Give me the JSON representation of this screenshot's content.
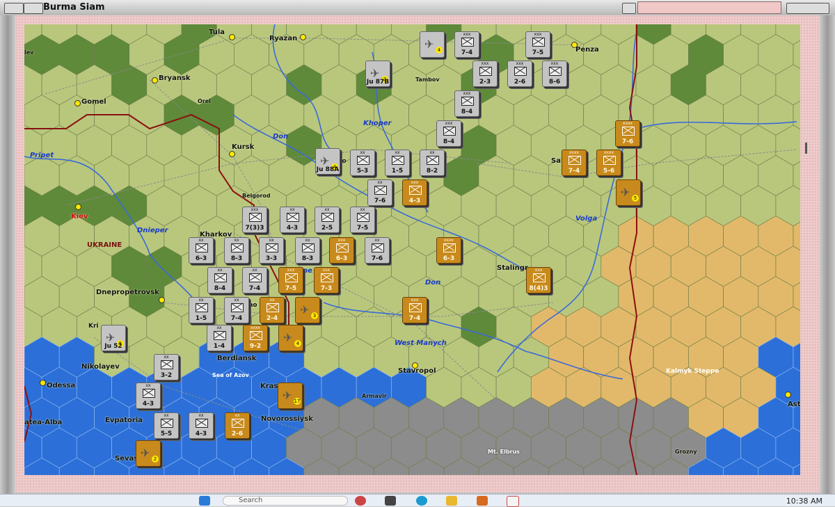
{
  "window": {
    "title": "Burma Siam"
  },
  "map": {
    "cities": [
      {
        "name": "Tula"
      },
      {
        "name": "Ryazan"
      },
      {
        "name": "Penza"
      },
      {
        "name": "Bryansk"
      },
      {
        "name": "Tambov"
      },
      {
        "name": "Orel"
      },
      {
        "name": "Gomel"
      },
      {
        "name": "Kursk"
      },
      {
        "name": "Saratov"
      },
      {
        "name": "Belgorod"
      },
      {
        "name": "Kiev"
      },
      {
        "name": "Kharkov"
      },
      {
        "name": "Stalingrad"
      },
      {
        "name": "Dnepropetrovsk"
      },
      {
        "name": "Nikolayev"
      },
      {
        "name": "Odessa"
      },
      {
        "name": "Berdiansk"
      },
      {
        "name": "Stavropol"
      },
      {
        "name": "Armavir"
      },
      {
        "name": "Krasnodar"
      },
      {
        "name": "Evpatoria"
      },
      {
        "name": "Novorossiysk"
      },
      {
        "name": "Sevastopol"
      },
      {
        "name": "Grozny"
      },
      {
        "name": "Astrakhan"
      },
      {
        "name": "Krivoi Rog"
      },
      {
        "name": "Feodosia-Alba"
      },
      {
        "name": "Rostov"
      }
    ],
    "city_labels_visible": {
      "tula": "Tula",
      "ryazan": "Ryazan",
      "penza": "Penza",
      "bryansk": "Bryansk",
      "tambov": "Tambov",
      "orel": "Orel",
      "gomel": "Gomel",
      "kursk": "Kursk",
      "saratov": "Sar",
      "belgorod": "Belgorod",
      "kiev": "Kiev",
      "kharkov": "Kharkov",
      "stalingrad": "Stalingr",
      "dnepropetrovsk": "Dnepropetrovsk",
      "nikolayev": "Nikolayev",
      "odessa": "Odessa",
      "berdiansk": "Berdiansk",
      "stavropol": "Stavropol",
      "armavir": "Armavir",
      "krasnodar": "Kras",
      "evpatoria": "Evpatoria",
      "novorossiysk": "Novorossiysk",
      "sevastopol": "Sevas",
      "grozny": "Grozny",
      "astrakhan": "Ast",
      "krivoi": "Kri",
      "alba": "atea-Alba",
      "lev": "lev",
      "voro": "ro",
      "rostov": "no"
    },
    "rivers": {
      "dnieper": "Dnieper",
      "don1": "Don",
      "khoper": "Khoper",
      "volga": "Volga",
      "don2": "Don",
      "pripet": "Pripet",
      "west_manych": "West Manych",
      "dnie2": "ne"
    },
    "regions": {
      "ukraine": "UKRAINE",
      "kalmyk": "Kalmyk Steppe",
      "sea_of_azov": "Sea of Azov",
      "elbrus": "Mt. Elbrus"
    },
    "colors": {
      "clear": "#b9c77d",
      "forest": "#5e8a3a",
      "steppe": "#e2b96a",
      "sea": "#2c6fd8",
      "mountain": "#8c8c8c",
      "border": "#8a1010"
    }
  },
  "counters": [
    {
      "side": "axis",
      "kind": "air",
      "strength": "",
      "badge": "4"
    },
    {
      "side": "soviet",
      "size": "xxx",
      "strength": "7-4"
    },
    {
      "side": "soviet",
      "size": "xxx",
      "strength": "7-5"
    },
    {
      "side": "axis",
      "kind": "air",
      "strength": "Ju 87B",
      "badge": "3"
    },
    {
      "side": "soviet",
      "size": "xxx",
      "strength": "2-3"
    },
    {
      "side": "soviet",
      "size": "xxx",
      "strength": "2-6"
    },
    {
      "side": "soviet",
      "size": "xxx",
      "strength": "8-6"
    },
    {
      "side": "soviet",
      "size": "xxx",
      "strength": "8-4"
    },
    {
      "side": "soviet",
      "size": "xxx",
      "strength": "8-4"
    },
    {
      "side": "german",
      "size": "xxxx",
      "strength": "7-6"
    },
    {
      "side": "german",
      "size": "xxxx",
      "strength": "7-4"
    },
    {
      "side": "german",
      "size": "xxxx",
      "strength": "5-6"
    },
    {
      "side": "german",
      "kind": "air",
      "strength": "",
      "badge": "5"
    },
    {
      "side": "axis",
      "kind": "air",
      "strength": "Ju 88A",
      "badge": "4"
    },
    {
      "side": "soviet",
      "size": "xx",
      "strength": "5-3"
    },
    {
      "side": "soviet",
      "size": "xx",
      "strength": "1-5"
    },
    {
      "side": "soviet",
      "size": "xx",
      "strength": "8-2"
    },
    {
      "side": "soviet",
      "size": "xx",
      "strength": "7-6"
    },
    {
      "side": "german",
      "size": "xxx",
      "strength": "4-3"
    },
    {
      "side": "soviet",
      "size": "xxx",
      "strength": "7(3)3"
    },
    {
      "side": "soviet",
      "size": "xx",
      "strength": "4-3"
    },
    {
      "side": "soviet",
      "size": "xx",
      "strength": "2-5"
    },
    {
      "side": "soviet",
      "size": "xx",
      "strength": "7-5"
    },
    {
      "side": "soviet",
      "size": "xx",
      "strength": "6-3"
    },
    {
      "side": "soviet",
      "size": "xx",
      "strength": "8-3"
    },
    {
      "side": "soviet",
      "size": "xx",
      "strength": "3-3"
    },
    {
      "side": "soviet",
      "size": "xx",
      "strength": "8-3"
    },
    {
      "side": "german",
      "size": "xxx",
      "strength": "6-3"
    },
    {
      "side": "soviet",
      "size": "xx",
      "strength": "7-6"
    },
    {
      "side": "german",
      "size": "xxxx",
      "strength": "6-3"
    },
    {
      "side": "soviet",
      "size": "xx",
      "strength": "8-4"
    },
    {
      "side": "soviet",
      "size": "xx",
      "strength": "7-4"
    },
    {
      "side": "german",
      "size": "xxx",
      "strength": "7-5"
    },
    {
      "side": "german",
      "size": "xxx",
      "strength": "7-3"
    },
    {
      "side": "german",
      "size": "xxx",
      "strength": "8(4)3"
    },
    {
      "side": "soviet",
      "size": "xx",
      "strength": "1-5"
    },
    {
      "side": "soviet",
      "size": "xx",
      "strength": "7-4"
    },
    {
      "side": "german",
      "size": "xx",
      "strength": "2-4"
    },
    {
      "side": "german",
      "kind": "air",
      "strength": "",
      "badge": "3"
    },
    {
      "side": "german",
      "size": "xxx",
      "strength": "7-4"
    },
    {
      "side": "soviet",
      "kind": "air",
      "strength": "Ju 52",
      "badge": "5"
    },
    {
      "side": "soviet",
      "size": "xx",
      "strength": "1-4"
    },
    {
      "side": "german",
      "size": "xxxx",
      "strength": "9-2"
    },
    {
      "side": "german",
      "kind": "air",
      "strength": "",
      "badge": "4"
    },
    {
      "side": "soviet",
      "size": "xx",
      "strength": "3-2"
    },
    {
      "side": "german",
      "kind": "air",
      "strength": "",
      "badge": "17"
    },
    {
      "side": "soviet",
      "size": "xx",
      "strength": "4-3"
    },
    {
      "side": "soviet",
      "size": "xx",
      "strength": "5-5"
    },
    {
      "side": "soviet",
      "size": "xx",
      "strength": "4-3"
    },
    {
      "side": "german",
      "size": "xx",
      "strength": "2-6"
    },
    {
      "side": "german",
      "kind": "air",
      "strength": "",
      "badge": "2"
    }
  ],
  "taskbar": {
    "search": "Search",
    "clock": "10:38 AM"
  }
}
